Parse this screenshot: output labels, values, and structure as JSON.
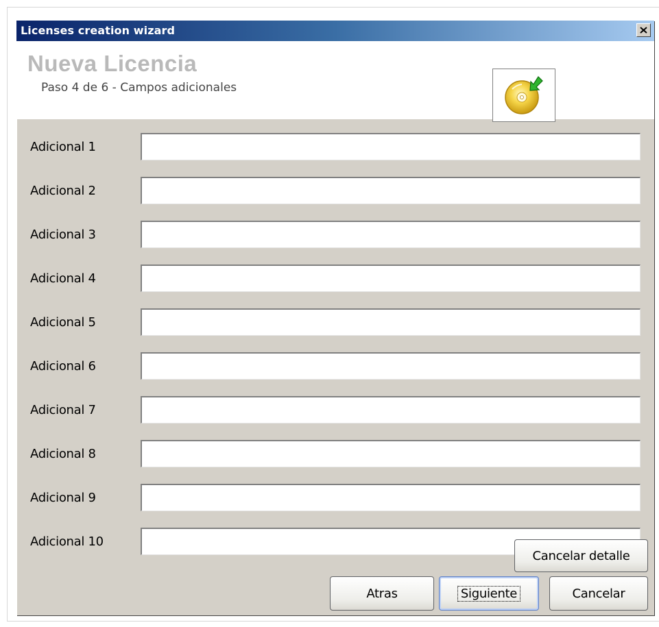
{
  "window": {
    "title": "Licenses creation wizard"
  },
  "header": {
    "title": "Nueva Licencia",
    "subtitle": "Paso 4 de 6 - Campos adicionales",
    "icon": "cd-import-icon"
  },
  "fields": [
    {
      "label": "Adicional 1",
      "value": ""
    },
    {
      "label": "Adicional 2",
      "value": ""
    },
    {
      "label": "Adicional 3",
      "value": ""
    },
    {
      "label": "Adicional 4",
      "value": ""
    },
    {
      "label": "Adicional 5",
      "value": ""
    },
    {
      "label": "Adicional 6",
      "value": ""
    },
    {
      "label": "Adicional 7",
      "value": ""
    },
    {
      "label": "Adicional 8",
      "value": ""
    },
    {
      "label": "Adicional 9",
      "value": ""
    },
    {
      "label": "Adicional 10",
      "value": ""
    }
  ],
  "buttons": {
    "cancel_detail": "Cancelar detalle",
    "back": "Atras",
    "next": "Siguiente",
    "cancel": "Cancelar"
  },
  "colors": {
    "titlebar_start": "#0a246a",
    "titlebar_end": "#a6caf0",
    "window_bg": "#d4d0c8"
  }
}
